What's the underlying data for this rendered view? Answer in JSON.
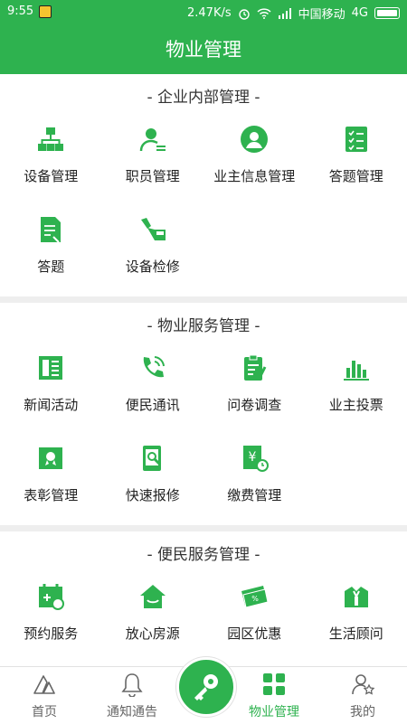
{
  "status_bar": {
    "time": "9:55",
    "speed": "2.47K/s",
    "carrier": "中国移动",
    "network": "4G"
  },
  "header": {
    "title": "物业管理"
  },
  "sections": [
    {
      "title": "- 企业内部管理 -",
      "items": [
        {
          "label": "设备管理",
          "icon": "hierarchy-icon"
        },
        {
          "label": "职员管理",
          "icon": "staff-icon"
        },
        {
          "label": "业主信息管理",
          "icon": "owner-profile-icon"
        },
        {
          "label": "答题管理",
          "icon": "checklist-icon"
        },
        {
          "label": "答题",
          "icon": "quiz-document-icon"
        },
        {
          "label": "设备检修",
          "icon": "repair-tools-icon"
        }
      ]
    },
    {
      "title": "- 物业服务管理 -",
      "items": [
        {
          "label": "新闻活动",
          "icon": "newspaper-icon"
        },
        {
          "label": "便民通讯",
          "icon": "phone-call-icon"
        },
        {
          "label": "问卷调查",
          "icon": "survey-clipboard-icon"
        },
        {
          "label": "业主投票",
          "icon": "bar-chart-icon"
        },
        {
          "label": "表彰管理",
          "icon": "award-certificate-icon"
        },
        {
          "label": "快速报修",
          "icon": "quick-repair-icon"
        },
        {
          "label": "缴费管理",
          "icon": "payment-yen-icon"
        }
      ]
    },
    {
      "title": "- 便民服务管理 -",
      "items": [
        {
          "label": "预约服务",
          "icon": "calendar-booking-icon"
        },
        {
          "label": "放心房源",
          "icon": "house-listing-icon"
        },
        {
          "label": "园区优惠",
          "icon": "discount-ticket-icon"
        },
        {
          "label": "生活顾问",
          "icon": "advisor-icon"
        }
      ]
    }
  ],
  "tab_bar": {
    "tabs": [
      {
        "label": "首页",
        "icon": "home-icon"
      },
      {
        "label": "通知通告",
        "icon": "bell-icon"
      },
      {
        "label": "物业管理",
        "icon": "grid-apps-icon",
        "active": true
      },
      {
        "label": "我的",
        "icon": "user-icon"
      }
    ],
    "center_icon": "key-icon"
  },
  "colors": {
    "brand": "#2eb24f",
    "background": "#eeeeee",
    "text": "#222222"
  }
}
